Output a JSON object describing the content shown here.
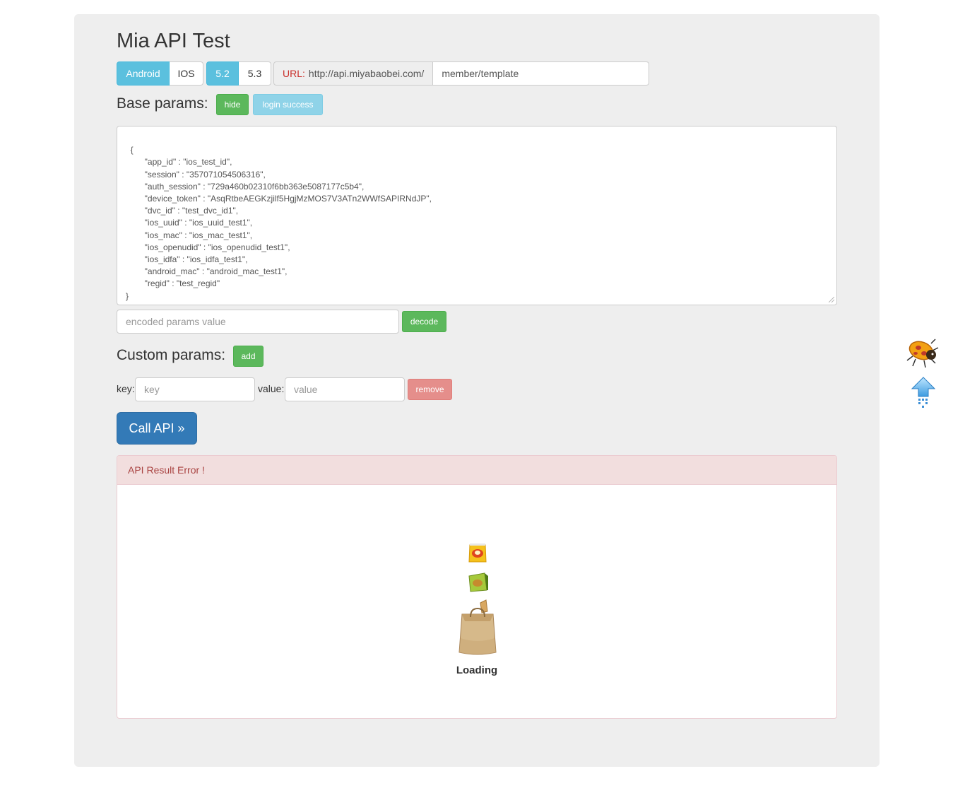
{
  "title": "Mia API Test",
  "platform_buttons": [
    {
      "label": "Android",
      "active": true
    },
    {
      "label": "IOS",
      "active": false
    }
  ],
  "version_buttons": [
    {
      "label": "5.2",
      "active": true
    },
    {
      "label": "5.3",
      "active": false
    }
  ],
  "url": {
    "label": "URL:",
    "base": "http://api.miyabaobei.com/",
    "path": "member/template"
  },
  "base_params": {
    "heading": "Base params:",
    "hide_label": "hide",
    "login_label": "login success",
    "json_text": "{\n        \"app_id\" : \"ios_test_id\",\n        \"session\" : \"357071054506316\",\n        \"auth_session\" : \"729a460b02310f6bb363e5087177c5b4\",\n        \"device_token\" : \"AsqRtbeAEGKzjilf5HgjMzMOS7V3ATn2WWfSAPIRNdJP\",\n        \"dvc_id\" : \"test_dvc_id1\",\n        \"ios_uuid\" : \"ios_uuid_test1\",\n        \"ios_mac\" : \"ios_mac_test1\",\n        \"ios_openudid\" : \"ios_openudid_test1\",\n        \"ios_idfa\" : \"ios_idfa_test1\",\n        \"android_mac\" : \"android_mac_test1\",\n        \"regid\" : \"test_regid\"\n}",
    "encoded_placeholder": "encoded params value",
    "decode_label": "decode"
  },
  "custom_params": {
    "heading": "Custom params:",
    "add_label": "add",
    "key_label": "key:",
    "key_placeholder": "key",
    "value_label": "value:",
    "value_placeholder": "value",
    "remove_label": "remove"
  },
  "call_api_label": "Call API »",
  "result": {
    "heading": "API Result Error !",
    "loading_text": "Loading"
  },
  "colors": {
    "active_info": "#5bc0de",
    "success": "#5cb85c",
    "primary": "#337ab7",
    "error_bg": "#f2dede",
    "error_text": "#a94442"
  },
  "side_icons": [
    "ladybug-icon",
    "scroll-to-top-arrow-icon"
  ]
}
